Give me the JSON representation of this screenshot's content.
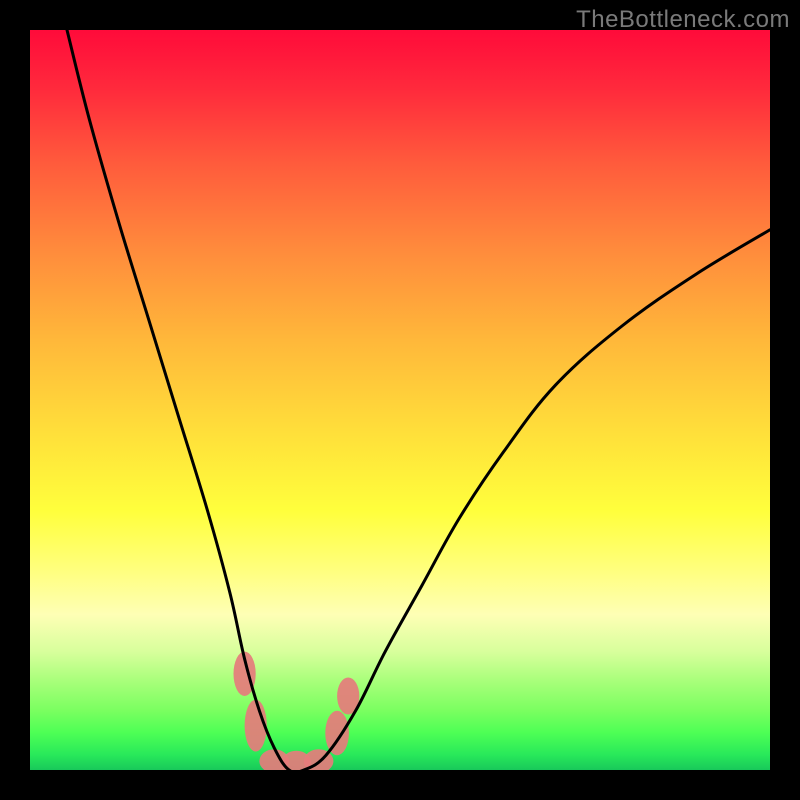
{
  "watermark": "TheBottleneck.com",
  "chart_data": {
    "type": "line",
    "title": "",
    "xlabel": "",
    "ylabel": "",
    "xlim": [
      0,
      100
    ],
    "ylim": [
      0,
      100
    ],
    "grid": false,
    "legend": false,
    "gradient_colors": {
      "top": "#ff0b3a",
      "mid": "#ffff3c",
      "bottom": "#18c85a"
    },
    "series": [
      {
        "name": "bottleneck-curve",
        "color": "#000000",
        "x": [
          5,
          8,
          12,
          16,
          20,
          24,
          27,
          29,
          31,
          33,
          35,
          37,
          40,
          44,
          48,
          53,
          58,
          64,
          71,
          80,
          90,
          100
        ],
        "values": [
          100,
          88,
          74,
          61,
          48,
          35,
          24,
          15,
          8,
          3,
          0,
          0,
          2,
          8,
          16,
          25,
          34,
          43,
          52,
          60,
          67,
          73
        ]
      }
    ],
    "markers": [
      {
        "name": "blob-left-upper",
        "cx": 29.0,
        "cy": 13.0,
        "rx": 1.5,
        "ry": 3.0,
        "color": "#e57c7c"
      },
      {
        "name": "blob-left-lower",
        "cx": 30.5,
        "cy": 6.0,
        "rx": 1.5,
        "ry": 3.5,
        "color": "#e57c7c"
      },
      {
        "name": "blob-bottom-1",
        "cx": 33.0,
        "cy": 1.2,
        "rx": 2.0,
        "ry": 1.6,
        "color": "#e57c7c"
      },
      {
        "name": "blob-bottom-2",
        "cx": 36.0,
        "cy": 1.0,
        "rx": 2.0,
        "ry": 1.6,
        "color": "#e57c7c"
      },
      {
        "name": "blob-bottom-3",
        "cx": 39.0,
        "cy": 1.2,
        "rx": 2.0,
        "ry": 1.6,
        "color": "#e57c7c"
      },
      {
        "name": "blob-right-lower",
        "cx": 41.5,
        "cy": 5.0,
        "rx": 1.6,
        "ry": 3.0,
        "color": "#e57c7c"
      },
      {
        "name": "blob-right-upper",
        "cx": 43.0,
        "cy": 10.0,
        "rx": 1.5,
        "ry": 2.5,
        "color": "#e57c7c"
      }
    ]
  }
}
